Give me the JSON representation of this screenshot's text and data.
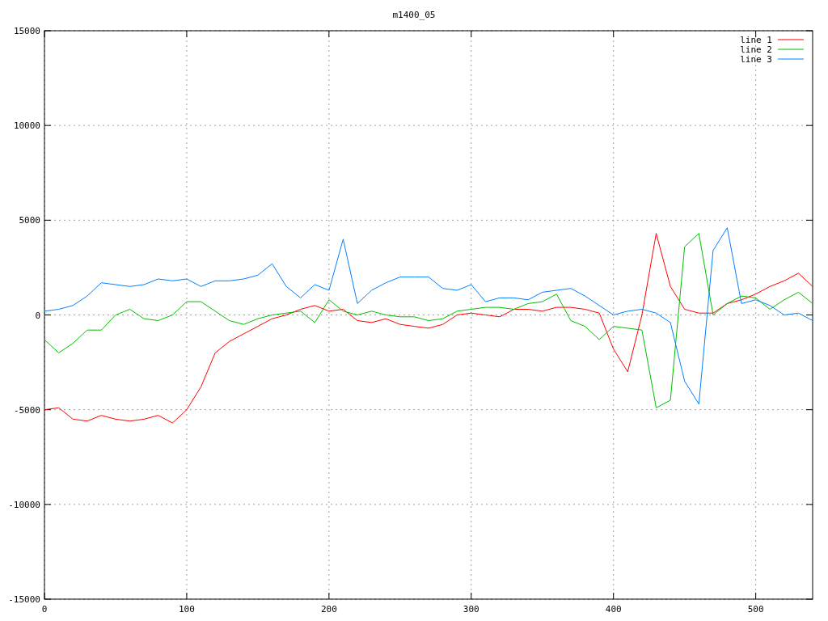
{
  "chart_data": {
    "type": "line",
    "title": "m1400_05",
    "x": [
      0,
      10,
      20,
      30,
      40,
      50,
      60,
      70,
      80,
      90,
      100,
      110,
      120,
      130,
      140,
      150,
      160,
      170,
      180,
      190,
      200,
      210,
      220,
      230,
      240,
      250,
      260,
      270,
      280,
      290,
      300,
      310,
      320,
      330,
      340,
      350,
      360,
      370,
      380,
      390,
      400,
      410,
      420,
      430,
      440,
      450,
      460,
      470,
      480,
      490,
      500,
      510,
      520,
      530,
      540
    ],
    "series": [
      {
        "name": "line 1",
        "color": "#ff0000",
        "values": [
          -5000,
          -4900,
          -5500,
          -5600,
          -5300,
          -5500,
          -5600,
          -5500,
          -5300,
          -5700,
          -5000,
          -3800,
          -2000,
          -1400,
          -1000,
          -600,
          -200,
          0,
          300,
          500,
          200,
          300,
          -300,
          -400,
          -200,
          -500,
          -600,
          -700,
          -500,
          0,
          100,
          0,
          -100,
          300,
          300,
          200,
          400,
          400,
          300,
          100,
          -1800,
          -3000,
          0,
          4300,
          1500,
          300,
          100,
          100,
          600,
          800,
          1100,
          1500,
          1800,
          2200,
          1500
        ]
      },
      {
        "name": "line 2",
        "color": "#00c000",
        "values": [
          -1300,
          -2000,
          -1500,
          -800,
          -800,
          0,
          300,
          -200,
          -300,
          0,
          700,
          700,
          200,
          -300,
          -500,
          -200,
          0,
          100,
          200,
          -400,
          800,
          200,
          0,
          200,
          0,
          -100,
          -100,
          -300,
          -200,
          200,
          300,
          400,
          400,
          300,
          600,
          700,
          1100,
          -300,
          -600,
          -1300,
          -600,
          -700,
          -800,
          -4900,
          -4500,
          3600,
          4300,
          0,
          600,
          1000,
          900,
          300,
          800,
          1200,
          600
        ]
      },
      {
        "name": "line 3",
        "color": "#0080ff",
        "values": [
          200,
          300,
          500,
          1000,
          1700,
          1600,
          1500,
          1600,
          1900,
          1800,
          1900,
          1500,
          1800,
          1800,
          1900,
          2100,
          2700,
          1500,
          900,
          1600,
          1300,
          4000,
          600,
          1300,
          1700,
          2000,
          2000,
          2000,
          1400,
          1300,
          1600,
          700,
          900,
          900,
          800,
          1200,
          1300,
          1400,
          1000,
          500,
          0,
          200,
          300,
          100,
          -400,
          -3500,
          -4700,
          3400,
          4600,
          600,
          800,
          500,
          0,
          100,
          -300
        ]
      }
    ],
    "xlim": [
      0,
      540
    ],
    "ylim": [
      -15000,
      15000
    ],
    "xticks": [
      0,
      100,
      200,
      300,
      400,
      500
    ],
    "yticks": [
      -15000,
      -10000,
      -5000,
      0,
      5000,
      10000,
      15000
    ],
    "grid": true,
    "legend": true
  }
}
